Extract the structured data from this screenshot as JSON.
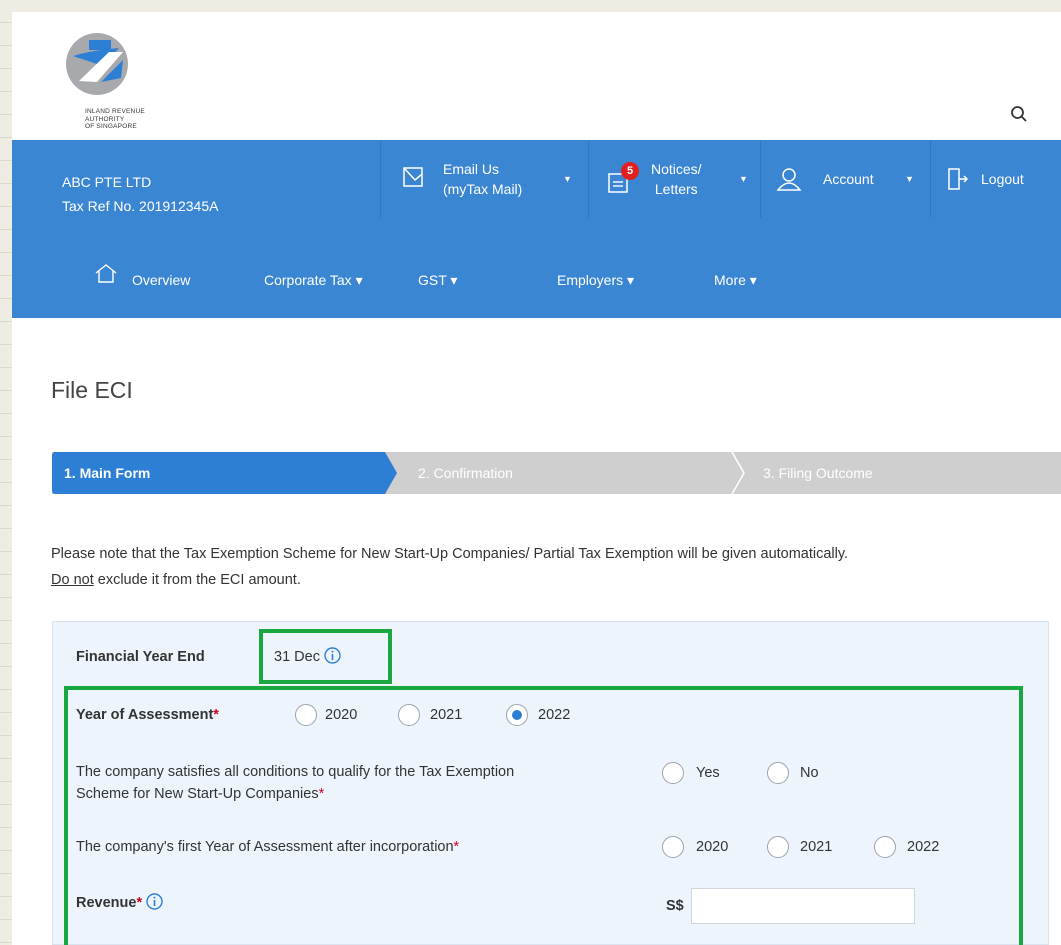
{
  "org": {
    "logo_text_lines": [
      "INLAND REVENUE",
      "AUTHORITY",
      "OF SINGAPORE"
    ]
  },
  "account": {
    "company": "ABC PTE LTD",
    "tax_ref": "Tax Ref No. 201912345A"
  },
  "topbar": {
    "email_line1": "Email Us",
    "email_line2": "(myTax Mail)",
    "notices_line1": "Notices/",
    "notices_line2": "Letters",
    "notices_badge": "5",
    "account_label": "Account",
    "logout_label": "Logout"
  },
  "nav": {
    "overview": "Overview",
    "corporate_tax": "Corporate Tax ▾",
    "gst": "GST ▾",
    "employers": "Employers ▾",
    "more": "More ▾"
  },
  "page": {
    "title": "File ECI"
  },
  "stepper": {
    "step1": "1. Main Form",
    "step2": "2. Confirmation",
    "step3": "3. Filing Outcome",
    "active_step": 1
  },
  "note": {
    "line1": "Please note that the Tax Exemption Scheme for New Start-Up Companies/ Partial Tax Exemption will be given automatically.",
    "do_not": "Do not",
    "line2_rest": " exclude it from the ECI amount."
  },
  "form": {
    "fye_label": "Financial Year End",
    "fye_value": "31 Dec",
    "ya_label": "Year of Assessment",
    "ya_options": [
      "2020",
      "2021",
      "2022"
    ],
    "ya_selected": "2022",
    "startup_label_line1": "The company satisfies all conditions to qualify for the Tax Exemption",
    "startup_label_line2": "Scheme for New Start-Up Companies",
    "startup_options": [
      "Yes",
      "No"
    ],
    "first_ya_label": "The company's first Year of Assessment after incorporation",
    "first_ya_options": [
      "2020",
      "2021",
      "2022"
    ],
    "revenue_label": "Revenue",
    "currency": "S$",
    "revenue_value": "",
    "required_mark": "*"
  },
  "colors": {
    "brand_blue": "#3a86d2",
    "highlight_green": "#19a83f",
    "required_red": "#d0021b"
  }
}
